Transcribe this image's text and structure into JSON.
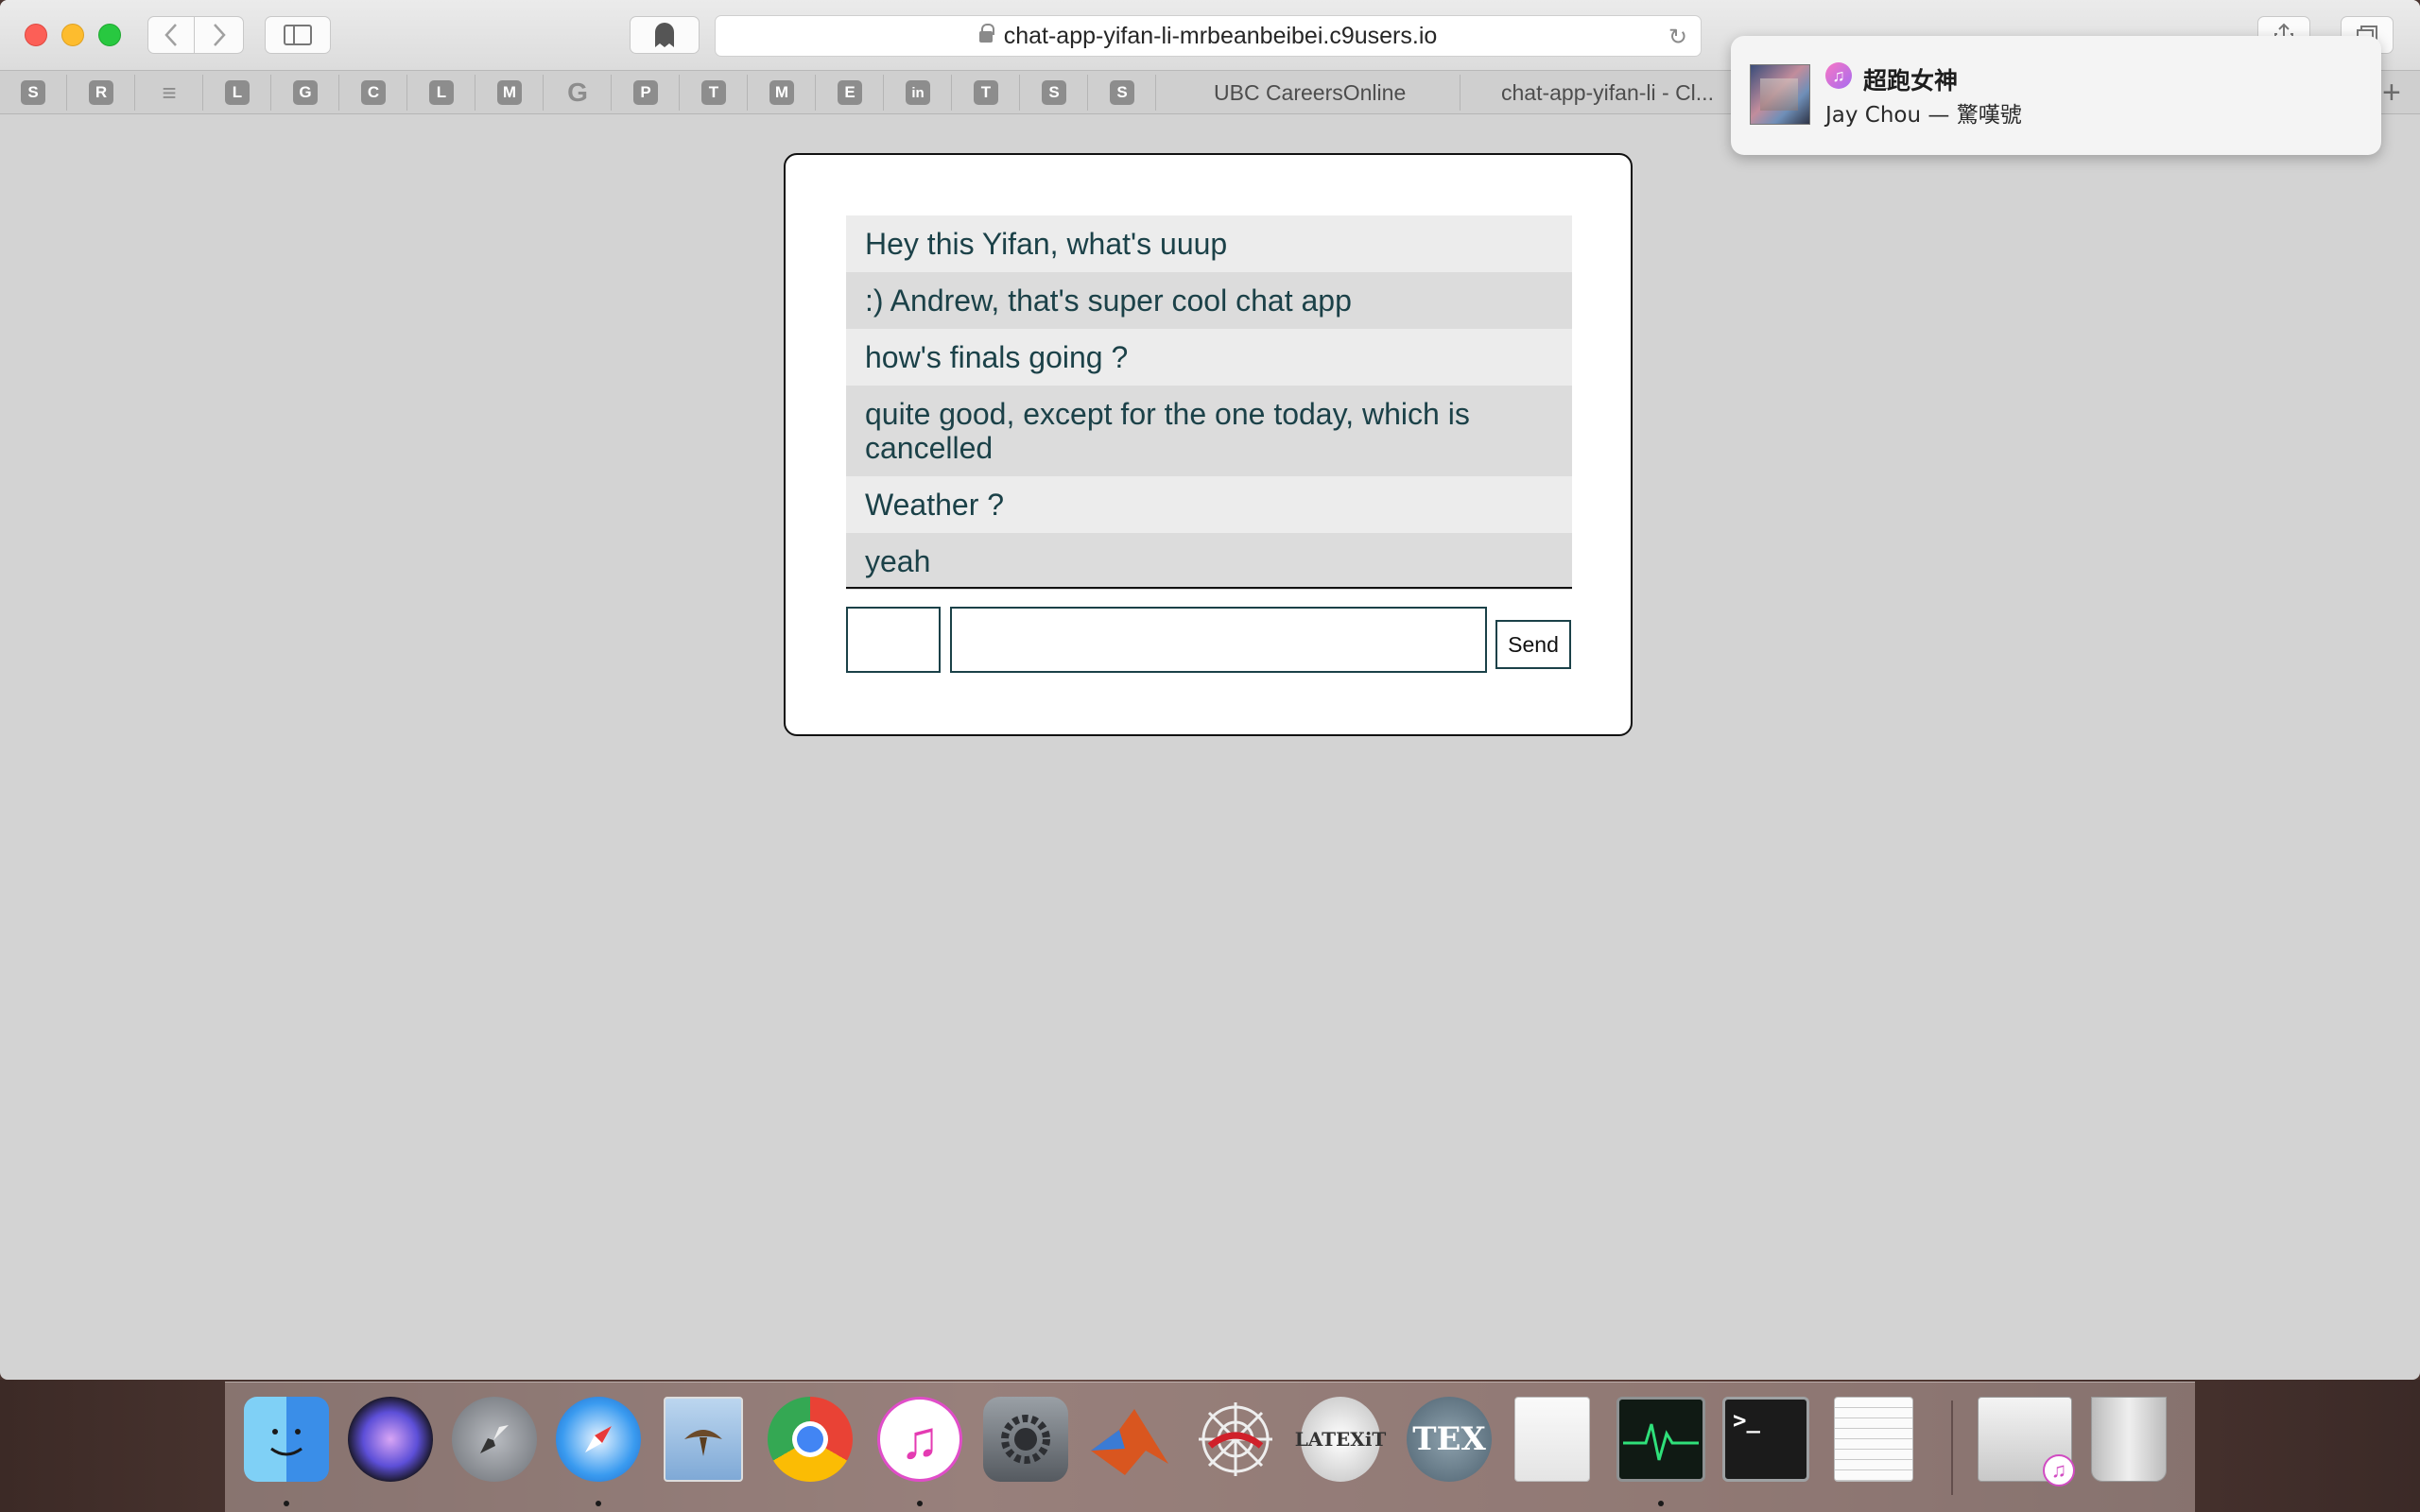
{
  "browser": {
    "url": "chat-app-yifan-li-mrbeanbeibei.c9users.io",
    "favorites": [
      "S",
      "R",
      "≡",
      "L",
      "G",
      "C",
      "L",
      "M",
      "G",
      "P",
      "T",
      "M",
      "E",
      "in",
      "T",
      "S",
      "S"
    ],
    "tabs": [
      "UBC CareersOnline",
      "chat-app-yifan-li - Cl..."
    ],
    "new_tab": "+"
  },
  "chat": {
    "messages": [
      "Hey this Yifan, what's uuup",
      ":) Andrew, that's super cool chat app",
      "how's finals going ?",
      "quite good, except for the one today, which is cancelled",
      "Weather ?",
      "yeah"
    ],
    "name_value": "",
    "message_value": "",
    "send_label": "Send"
  },
  "notification": {
    "title": "超跑女神",
    "subtitle": "Jay Chou — 驚嘆號"
  },
  "dock": {
    "apps": [
      "finder",
      "siri",
      "launchpad",
      "safari",
      "mail",
      "chrome",
      "itunes",
      "system-preferences",
      "matlab",
      "web",
      "latexit",
      "tex",
      "file",
      "activity-monitor",
      "terminal",
      "textedit",
      "screenshot",
      "trash"
    ]
  },
  "colors": {
    "page_bg": "#d3d3d3",
    "message_text": "#1b4148",
    "message_odd": "#ececec",
    "message_even": "#dcdcdc"
  }
}
